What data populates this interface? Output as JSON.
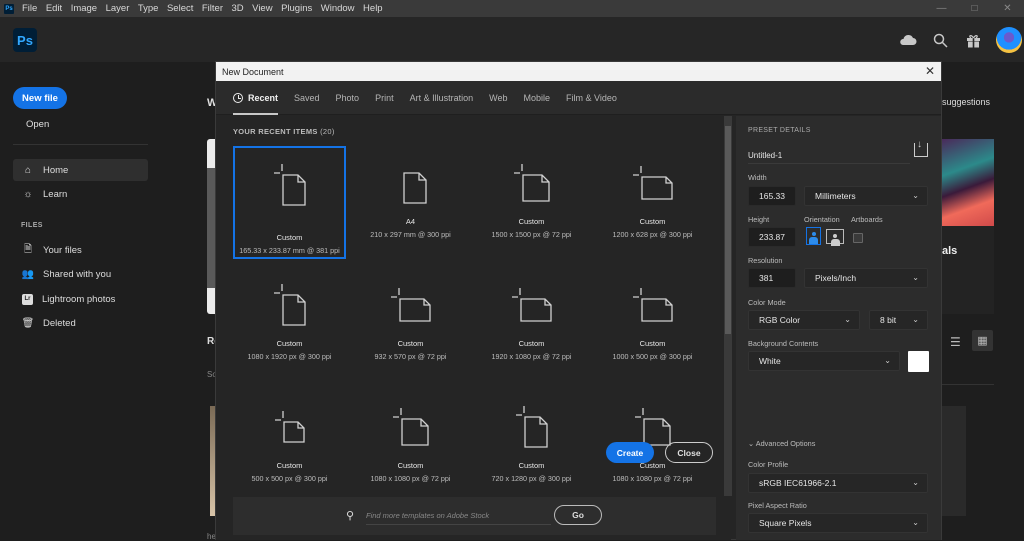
{
  "menubar": {
    "app_icon": "Ps",
    "items": [
      "File",
      "Edit",
      "Image",
      "Layer",
      "Type",
      "Select",
      "Filter",
      "3D",
      "View",
      "Plugins",
      "Window",
      "Help"
    ],
    "controls": [
      "minimize-icon",
      "maximize-icon",
      "close-icon"
    ]
  },
  "topbar": {
    "logo": "Ps",
    "icons": [
      "cloud-icon",
      "search-icon",
      "gift-icon",
      "avatar"
    ]
  },
  "sidebar": {
    "new_file": "New file",
    "open": "Open",
    "nav": [
      {
        "label": "Home",
        "icon": "home-icon",
        "active": true
      },
      {
        "label": "Learn",
        "icon": "lightbulb-icon",
        "active": false
      }
    ],
    "files_heading": "FILES",
    "files": [
      {
        "label": "Your files",
        "icon": "file-icon"
      },
      {
        "label": "Shared with you",
        "icon": "people-icon"
      },
      {
        "label": "Lightroom photos",
        "icon": "lightroom-icon"
      },
      {
        "label": "Deleted",
        "icon": "trash-icon"
      }
    ]
  },
  "background": {
    "welcome_fragment": "W",
    "recent_fragment": "Re",
    "sort_fragment": "So",
    "suggestions_fragment": "suggestions",
    "card_fragment": "als",
    "bottom_fragment": "he"
  },
  "dialog": {
    "title": "New Document",
    "tabs": [
      {
        "label": "Recent",
        "active": true
      },
      {
        "label": "Saved"
      },
      {
        "label": "Photo"
      },
      {
        "label": "Print"
      },
      {
        "label": "Art & Illustration"
      },
      {
        "label": "Web"
      },
      {
        "label": "Mobile"
      },
      {
        "label": "Film & Video"
      }
    ],
    "recent_heading": "YOUR RECENT ITEMS",
    "recent_count": "(20)",
    "items": [
      {
        "name": "Custom",
        "dims": "165.33 x 233.87 mm @ 381 ppi",
        "selected": true,
        "shape": "portrait",
        "crosshair": true
      },
      {
        "name": "A4",
        "dims": "210 x 297 mm @ 300 ppi",
        "shape": "portrait",
        "crosshair": false
      },
      {
        "name": "Custom",
        "dims": "1500 x 1500 px @ 72 ppi",
        "shape": "square",
        "crosshair": true
      },
      {
        "name": "Custom",
        "dims": "1200 x 628 px @ 300 ppi",
        "shape": "landscape",
        "crosshair": true
      },
      {
        "name": "Custom",
        "dims": "1080 x 1920 px @ 300 ppi",
        "shape": "portrait",
        "crosshair": true
      },
      {
        "name": "Custom",
        "dims": "932 x 570 px @ 72 ppi",
        "shape": "landscape",
        "crosshair": true
      },
      {
        "name": "Custom",
        "dims": "1920 x 1080 px @ 72 ppi",
        "shape": "landscape",
        "crosshair": true
      },
      {
        "name": "Custom",
        "dims": "1000 x 500 px @ 300 ppi",
        "shape": "landscape",
        "crosshair": true
      },
      {
        "name": "Custom",
        "dims": "500 x 500 px @ 300 ppi",
        "shape": "square-sm",
        "crosshair": true
      },
      {
        "name": "Custom",
        "dims": "1080 x 1080 px @ 72 ppi",
        "shape": "square",
        "crosshair": true
      },
      {
        "name": "Custom",
        "dims": "720 x 1280 px @ 300 ppi",
        "shape": "portrait",
        "crosshair": true
      },
      {
        "name": "Custom",
        "dims": "1080 x 1080 px @ 72 ppi",
        "shape": "square",
        "crosshair": true
      }
    ],
    "search": {
      "placeholder": "Find more templates on Adobe Stock",
      "value": "",
      "go": "Go"
    },
    "preset": {
      "heading": "PRESET DETAILS",
      "name": "Untitled-1",
      "width_label": "Width",
      "width": "165.33",
      "width_unit": "Millimeters",
      "height_label": "Height",
      "height": "233.87",
      "orientation_label": "Orientation",
      "orientation": "portrait",
      "artboards_label": "Artboards",
      "artboards": false,
      "resolution_label": "Resolution",
      "resolution": "381",
      "resolution_unit": "Pixels/Inch",
      "color_mode_label": "Color Mode",
      "color_mode": "RGB Color",
      "bit_depth": "8 bit",
      "background_label": "Background Contents",
      "background": "White",
      "background_swatch": "#ffffff",
      "advanced": "Advanced Options",
      "color_profile_label": "Color Profile",
      "color_profile": "sRGB IEC61966-2.1",
      "pixel_aspect_label": "Pixel Aspect Ratio",
      "pixel_aspect": "Square Pixels"
    },
    "create": "Create",
    "close": "Close"
  },
  "colors": {
    "accent": "#1473e6",
    "ps_blue": "#31a8ff",
    "ps_dark": "#001e36"
  }
}
